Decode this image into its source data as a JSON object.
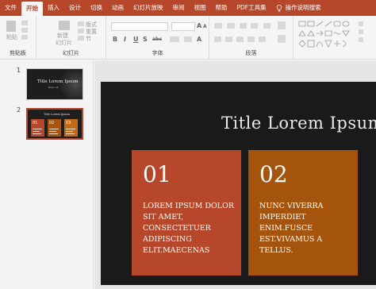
{
  "ribbon": {
    "tabs": [
      "文件",
      "开始",
      "插入",
      "设计",
      "切换",
      "动画",
      "幻灯片放映",
      "审阅",
      "视图",
      "帮助",
      "PDF工具集"
    ],
    "active_tab": "开始",
    "tell_me": "操作说明搜索",
    "groups": {
      "clipboard": "剪贴板",
      "slides": "幻灯片",
      "font": "字体",
      "paragraph": "段落"
    },
    "clipboard_items": {
      "paste": "粘贴"
    },
    "slides_items": {
      "new_slide": "新建",
      "new_slide2": "幻灯片",
      "layout": "版式",
      "reset": "重置",
      "section": "节"
    },
    "font_buttons": {
      "grow": "A",
      "shrink": "A",
      "clear": "A",
      "bold": "B",
      "italic": "I",
      "underline": "U",
      "shadow": "S",
      "strike": "abc"
    }
  },
  "accent_color": "#b7472a",
  "thumbnails": [
    {
      "number": "1",
      "title": "Title Lorem Ipsum",
      "subtitle": "Dolor sit"
    },
    {
      "number": "2",
      "title": "Title Lorem Ipsum",
      "cards": [
        "01",
        "02",
        "03"
      ]
    }
  ],
  "slide": {
    "title": "Title Lorem Ipsum",
    "cards": [
      {
        "number": "01",
        "text": "LOREM IPSUM DOLOR\nSIT AMET,\nCONSECTETUER\nADIPISCING\nELIT.MAECENAS",
        "color": "#b7472a"
      },
      {
        "number": "02",
        "text": "NUNC VIVERRA\nIMPERDIET\nENIM.FUSCE\nEST.VIVAMUS A\nTELLUS.",
        "color": "#a5540e"
      }
    ]
  }
}
